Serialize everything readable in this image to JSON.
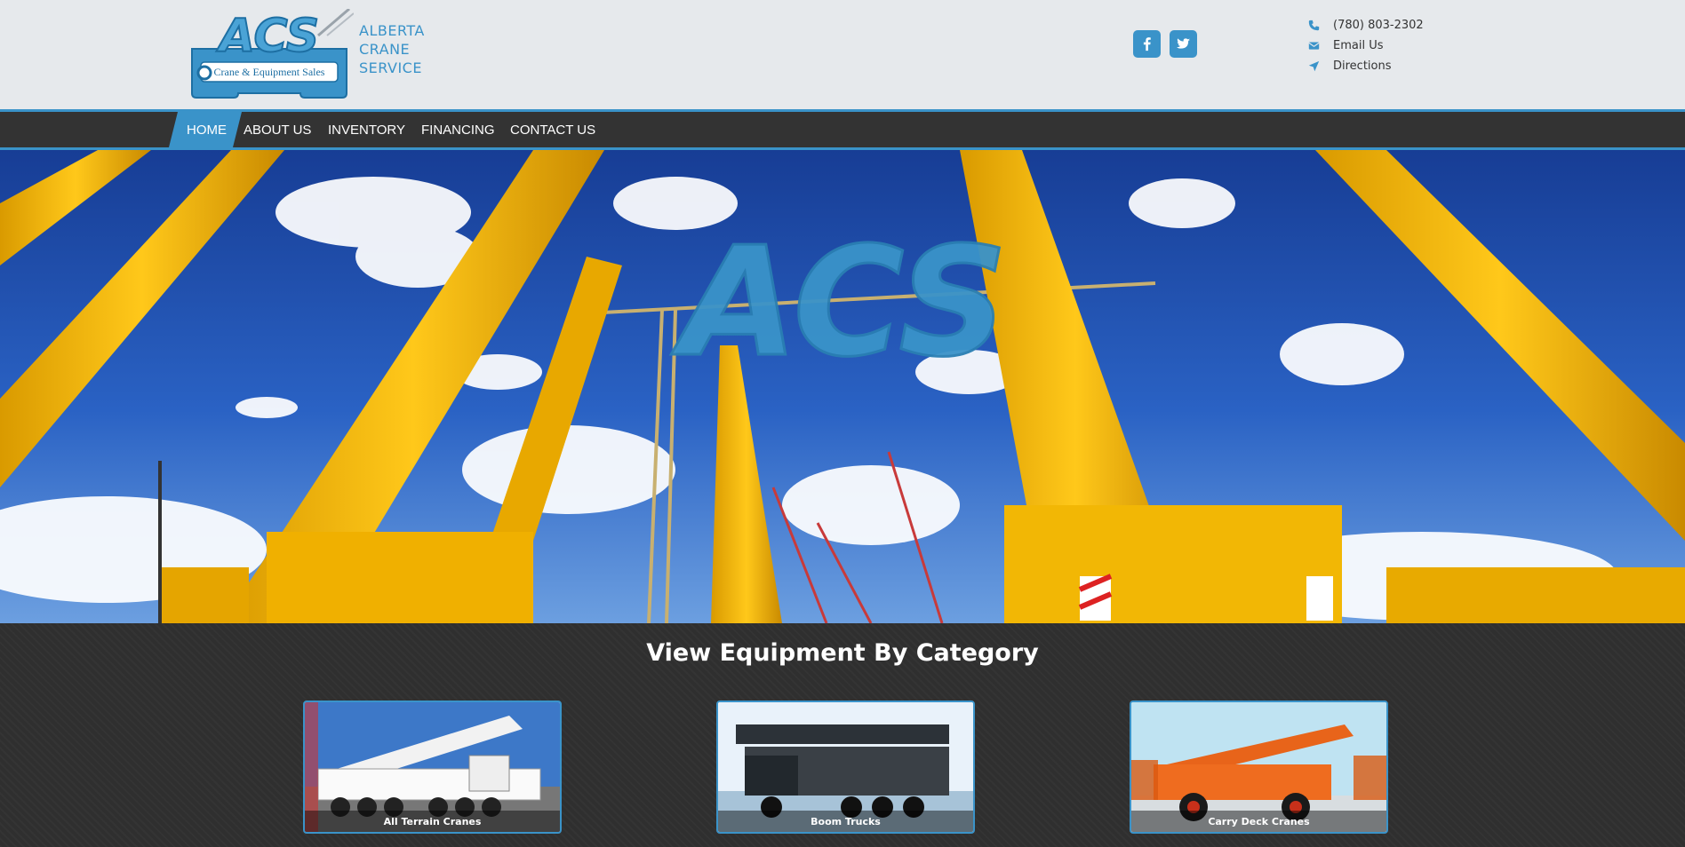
{
  "brand": {
    "logo_text": "ACS",
    "logo_subtext": "Crane & Equipment Sales",
    "name_lines": [
      "ALBERTA",
      "CRANE",
      "SERVICE"
    ]
  },
  "social": [
    {
      "label": "Facebook",
      "icon": "facebook-icon"
    },
    {
      "label": "Twitter",
      "icon": "twitter-icon"
    }
  ],
  "contact": {
    "phone": "(780) 803-2302",
    "email": "Email Us",
    "directions": "Directions"
  },
  "nav": {
    "items": [
      "HOME",
      "ABOUT US",
      "INVENTORY",
      "FINANCING",
      "CONTACT US"
    ],
    "active": "HOME"
  },
  "hero": {
    "overlay_logo_text": "ACS"
  },
  "categories": {
    "title": "View Equipment By Category",
    "items": [
      {
        "label": "All Terrain Cranes"
      },
      {
        "label": "Boom Trucks"
      },
      {
        "label": "Carry Deck Cranes"
      }
    ]
  },
  "colors": {
    "accent": "#3a93c9",
    "header_bg": "#e6e9ec",
    "nav_bg": "#333333",
    "section_bg": "#2f2f2f",
    "crane_yellow": "#f2b705",
    "sky_blue": "#1f4fae"
  }
}
